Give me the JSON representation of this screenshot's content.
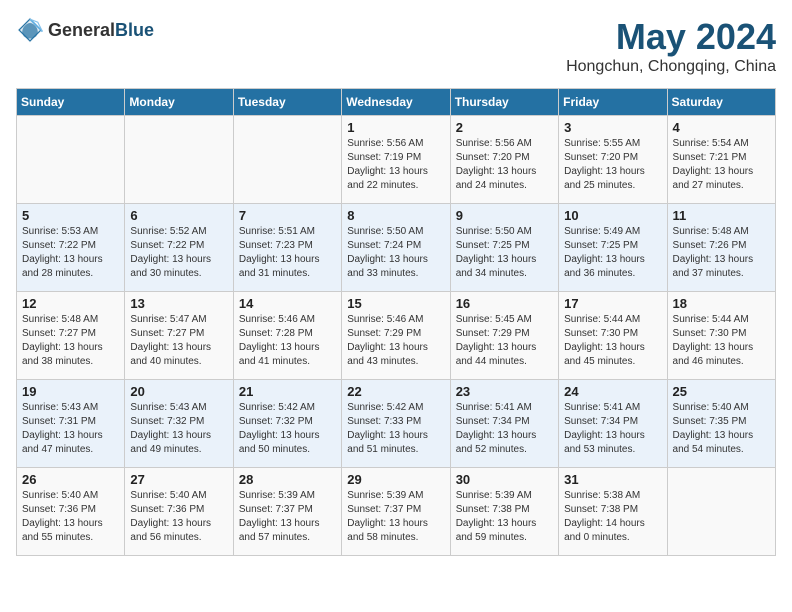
{
  "header": {
    "logo_general": "General",
    "logo_blue": "Blue",
    "main_title": "May 2024",
    "subtitle": "Hongchun, Chongqing, China"
  },
  "calendar": {
    "days_of_week": [
      "Sunday",
      "Monday",
      "Tuesday",
      "Wednesday",
      "Thursday",
      "Friday",
      "Saturday"
    ],
    "weeks": [
      [
        {
          "day": "",
          "sunrise": "",
          "sunset": "",
          "daylight": ""
        },
        {
          "day": "",
          "sunrise": "",
          "sunset": "",
          "daylight": ""
        },
        {
          "day": "",
          "sunrise": "",
          "sunset": "",
          "daylight": ""
        },
        {
          "day": "1",
          "sunrise": "Sunrise: 5:56 AM",
          "sunset": "Sunset: 7:19 PM",
          "daylight": "Daylight: 13 hours and 22 minutes."
        },
        {
          "day": "2",
          "sunrise": "Sunrise: 5:56 AM",
          "sunset": "Sunset: 7:20 PM",
          "daylight": "Daylight: 13 hours and 24 minutes."
        },
        {
          "day": "3",
          "sunrise": "Sunrise: 5:55 AM",
          "sunset": "Sunset: 7:20 PM",
          "daylight": "Daylight: 13 hours and 25 minutes."
        },
        {
          "day": "4",
          "sunrise": "Sunrise: 5:54 AM",
          "sunset": "Sunset: 7:21 PM",
          "daylight": "Daylight: 13 hours and 27 minutes."
        }
      ],
      [
        {
          "day": "5",
          "sunrise": "Sunrise: 5:53 AM",
          "sunset": "Sunset: 7:22 PM",
          "daylight": "Daylight: 13 hours and 28 minutes."
        },
        {
          "day": "6",
          "sunrise": "Sunrise: 5:52 AM",
          "sunset": "Sunset: 7:22 PM",
          "daylight": "Daylight: 13 hours and 30 minutes."
        },
        {
          "day": "7",
          "sunrise": "Sunrise: 5:51 AM",
          "sunset": "Sunset: 7:23 PM",
          "daylight": "Daylight: 13 hours and 31 minutes."
        },
        {
          "day": "8",
          "sunrise": "Sunrise: 5:50 AM",
          "sunset": "Sunset: 7:24 PM",
          "daylight": "Daylight: 13 hours and 33 minutes."
        },
        {
          "day": "9",
          "sunrise": "Sunrise: 5:50 AM",
          "sunset": "Sunset: 7:25 PM",
          "daylight": "Daylight: 13 hours and 34 minutes."
        },
        {
          "day": "10",
          "sunrise": "Sunrise: 5:49 AM",
          "sunset": "Sunset: 7:25 PM",
          "daylight": "Daylight: 13 hours and 36 minutes."
        },
        {
          "day": "11",
          "sunrise": "Sunrise: 5:48 AM",
          "sunset": "Sunset: 7:26 PM",
          "daylight": "Daylight: 13 hours and 37 minutes."
        }
      ],
      [
        {
          "day": "12",
          "sunrise": "Sunrise: 5:48 AM",
          "sunset": "Sunset: 7:27 PM",
          "daylight": "Daylight: 13 hours and 38 minutes."
        },
        {
          "day": "13",
          "sunrise": "Sunrise: 5:47 AM",
          "sunset": "Sunset: 7:27 PM",
          "daylight": "Daylight: 13 hours and 40 minutes."
        },
        {
          "day": "14",
          "sunrise": "Sunrise: 5:46 AM",
          "sunset": "Sunset: 7:28 PM",
          "daylight": "Daylight: 13 hours and 41 minutes."
        },
        {
          "day": "15",
          "sunrise": "Sunrise: 5:46 AM",
          "sunset": "Sunset: 7:29 PM",
          "daylight": "Daylight: 13 hours and 43 minutes."
        },
        {
          "day": "16",
          "sunrise": "Sunrise: 5:45 AM",
          "sunset": "Sunset: 7:29 PM",
          "daylight": "Daylight: 13 hours and 44 minutes."
        },
        {
          "day": "17",
          "sunrise": "Sunrise: 5:44 AM",
          "sunset": "Sunset: 7:30 PM",
          "daylight": "Daylight: 13 hours and 45 minutes."
        },
        {
          "day": "18",
          "sunrise": "Sunrise: 5:44 AM",
          "sunset": "Sunset: 7:30 PM",
          "daylight": "Daylight: 13 hours and 46 minutes."
        }
      ],
      [
        {
          "day": "19",
          "sunrise": "Sunrise: 5:43 AM",
          "sunset": "Sunset: 7:31 PM",
          "daylight": "Daylight: 13 hours and 47 minutes."
        },
        {
          "day": "20",
          "sunrise": "Sunrise: 5:43 AM",
          "sunset": "Sunset: 7:32 PM",
          "daylight": "Daylight: 13 hours and 49 minutes."
        },
        {
          "day": "21",
          "sunrise": "Sunrise: 5:42 AM",
          "sunset": "Sunset: 7:32 PM",
          "daylight": "Daylight: 13 hours and 50 minutes."
        },
        {
          "day": "22",
          "sunrise": "Sunrise: 5:42 AM",
          "sunset": "Sunset: 7:33 PM",
          "daylight": "Daylight: 13 hours and 51 minutes."
        },
        {
          "day": "23",
          "sunrise": "Sunrise: 5:41 AM",
          "sunset": "Sunset: 7:34 PM",
          "daylight": "Daylight: 13 hours and 52 minutes."
        },
        {
          "day": "24",
          "sunrise": "Sunrise: 5:41 AM",
          "sunset": "Sunset: 7:34 PM",
          "daylight": "Daylight: 13 hours and 53 minutes."
        },
        {
          "day": "25",
          "sunrise": "Sunrise: 5:40 AM",
          "sunset": "Sunset: 7:35 PM",
          "daylight": "Daylight: 13 hours and 54 minutes."
        }
      ],
      [
        {
          "day": "26",
          "sunrise": "Sunrise: 5:40 AM",
          "sunset": "Sunset: 7:36 PM",
          "daylight": "Daylight: 13 hours and 55 minutes."
        },
        {
          "day": "27",
          "sunrise": "Sunrise: 5:40 AM",
          "sunset": "Sunset: 7:36 PM",
          "daylight": "Daylight: 13 hours and 56 minutes."
        },
        {
          "day": "28",
          "sunrise": "Sunrise: 5:39 AM",
          "sunset": "Sunset: 7:37 PM",
          "daylight": "Daylight: 13 hours and 57 minutes."
        },
        {
          "day": "29",
          "sunrise": "Sunrise: 5:39 AM",
          "sunset": "Sunset: 7:37 PM",
          "daylight": "Daylight: 13 hours and 58 minutes."
        },
        {
          "day": "30",
          "sunrise": "Sunrise: 5:39 AM",
          "sunset": "Sunset: 7:38 PM",
          "daylight": "Daylight: 13 hours and 59 minutes."
        },
        {
          "day": "31",
          "sunrise": "Sunrise: 5:38 AM",
          "sunset": "Sunset: 7:38 PM",
          "daylight": "Daylight: 14 hours and 0 minutes."
        },
        {
          "day": "",
          "sunrise": "",
          "sunset": "",
          "daylight": ""
        }
      ]
    ]
  }
}
